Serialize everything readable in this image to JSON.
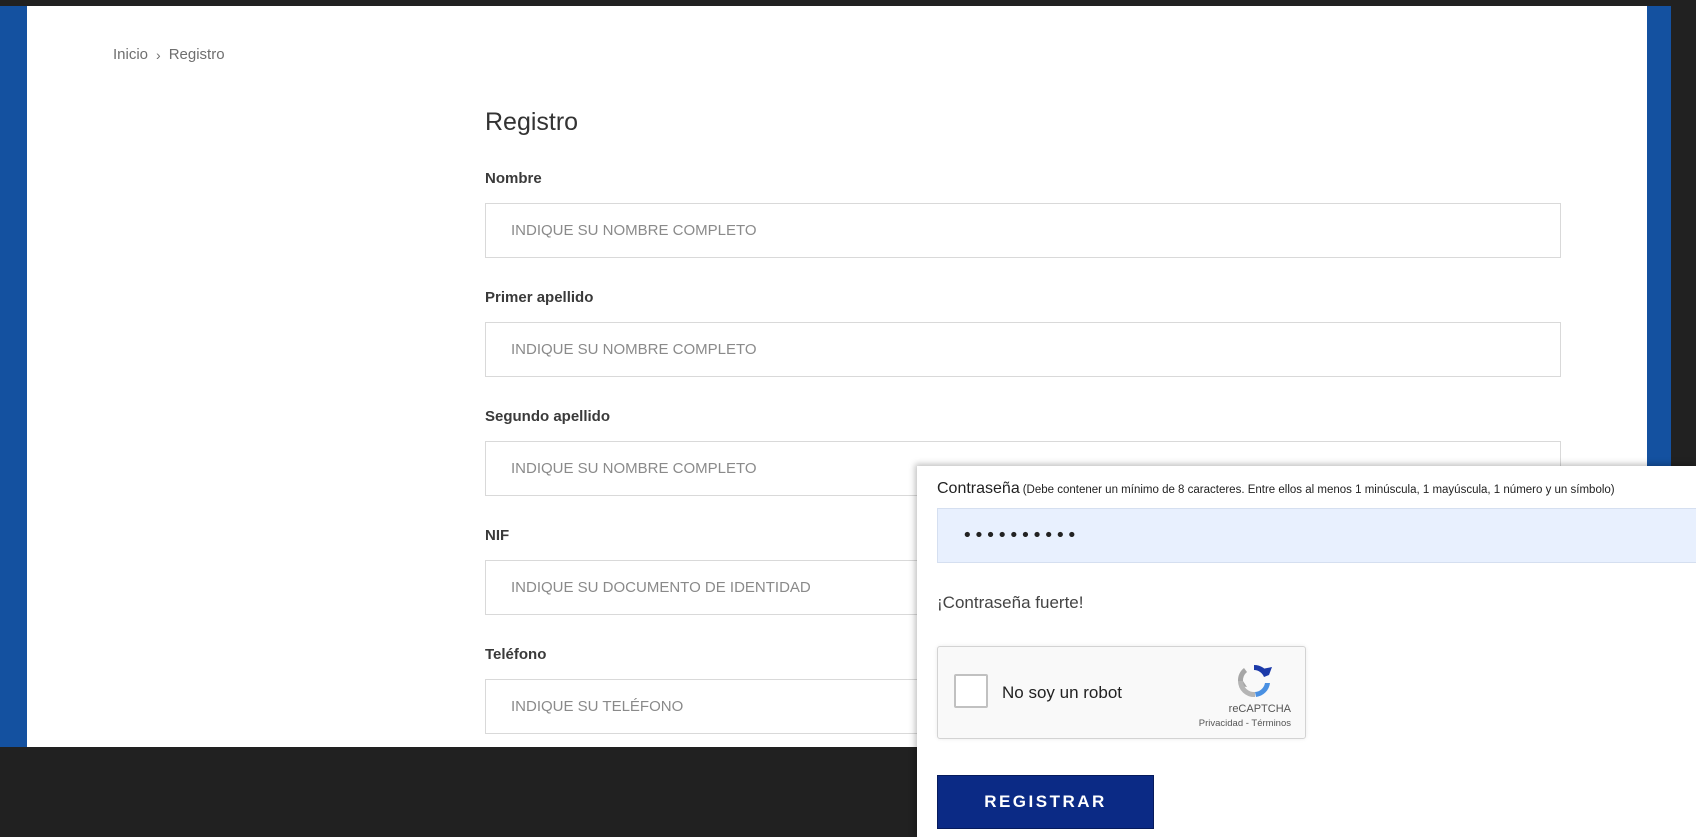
{
  "breadcrumb": {
    "home": "Inicio",
    "separator": "›",
    "current": "Registro"
  },
  "form": {
    "title": "Registro",
    "fields": [
      {
        "label": "Nombre",
        "placeholder": "INDIQUE SU NOMBRE COMPLETO",
        "value": ""
      },
      {
        "label": "Primer apellido",
        "placeholder": "INDIQUE SU NOMBRE COMPLETO",
        "value": ""
      },
      {
        "label": "Segundo apellido",
        "placeholder": "INDIQUE SU NOMBRE COMPLETO",
        "value": ""
      },
      {
        "label": "NIF",
        "placeholder": "INDIQUE SU DOCUMENTO DE IDENTIDAD",
        "value": ""
      },
      {
        "label": "Teléfono",
        "placeholder": "INDIQUE SU TELÉFONO",
        "value": ""
      }
    ]
  },
  "password": {
    "label": "Contraseña",
    "hint": "(Debe contener un mínimo de 8 caracteres. Entre ellos al menos 1 minúscula, 1 mayúscula, 1 número y un símbolo)",
    "value": "••••••••••",
    "strength": "¡Contraseña fuerte!"
  },
  "captcha": {
    "label": "No soy un robot",
    "brand": "reCAPTCHA",
    "privacy": "Privacidad",
    "link_separator": "-",
    "terms": "Términos",
    "checked": false
  },
  "submit": {
    "label": "REGISTRAR"
  },
  "colors": {
    "frame_blue": "#1451a0",
    "button_navy": "#0b2a85",
    "autofill_bg": "#e8f0fe"
  }
}
